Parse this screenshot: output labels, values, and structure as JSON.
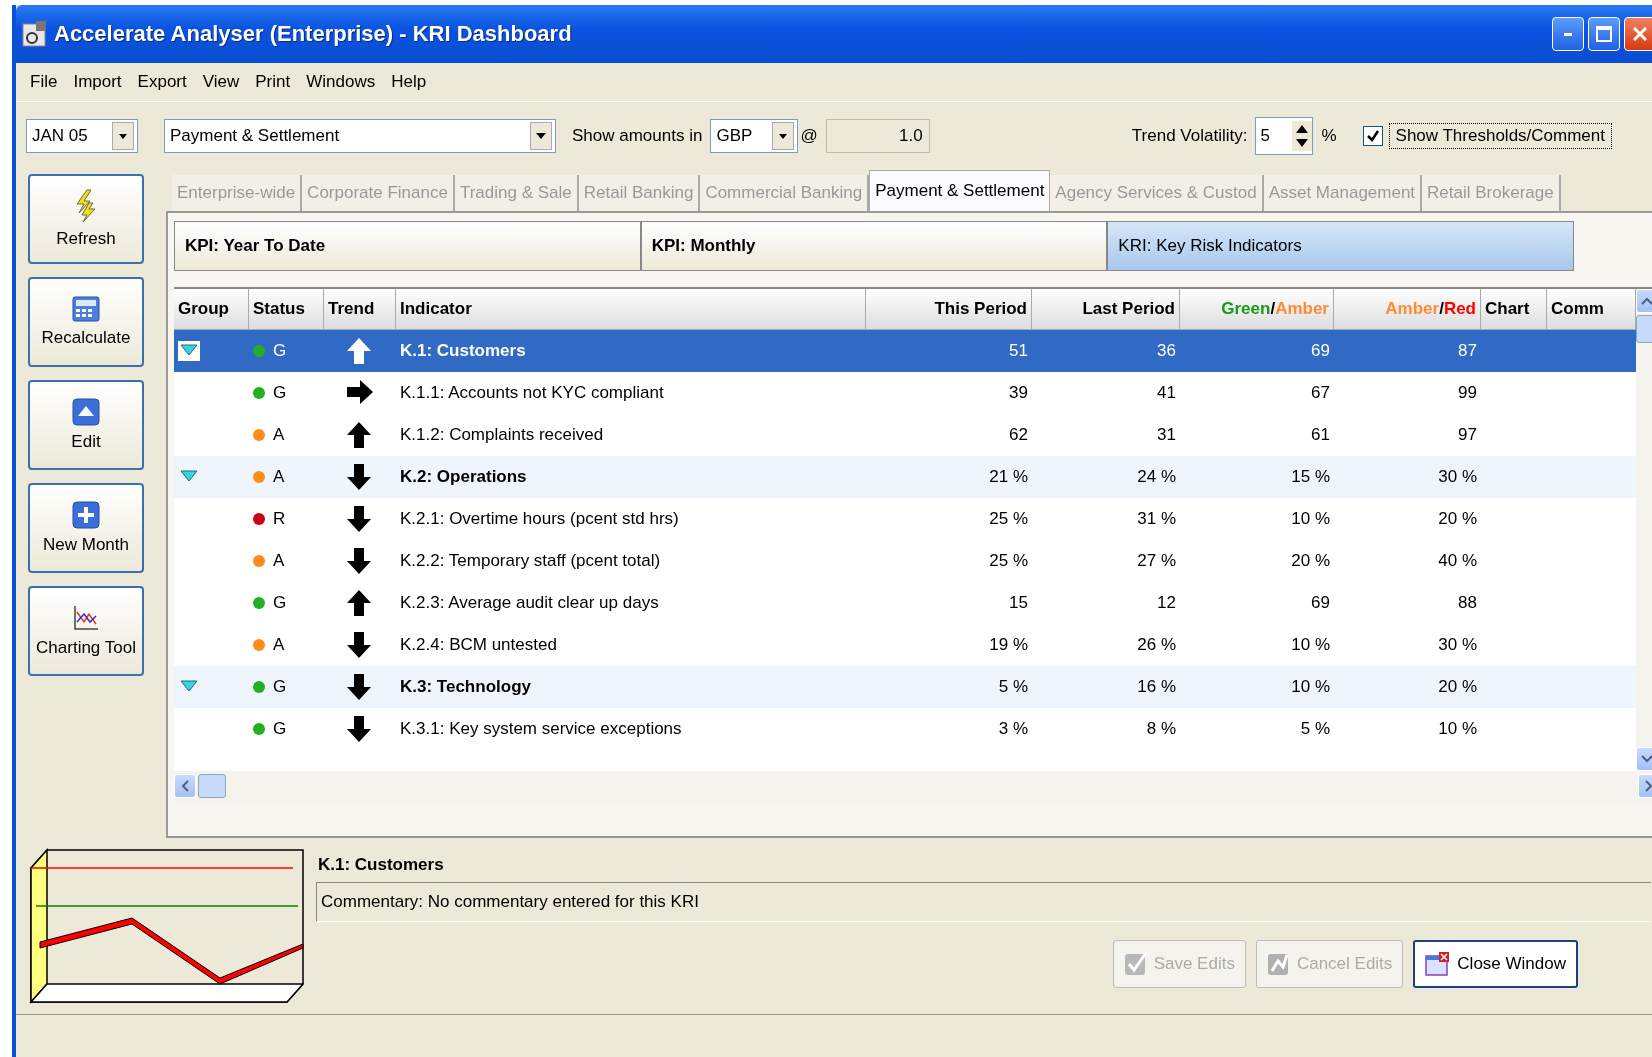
{
  "window": {
    "title": "Accelerate Analyser (Enterprise) - KRI Dashboard"
  },
  "menu": [
    "File",
    "Import",
    "Export",
    "View",
    "Print",
    "Windows",
    "Help"
  ],
  "toolbar": {
    "month": "JAN 05",
    "category": "Payment & Settlement",
    "amounts_label": "Show amounts in",
    "currency": "GBP",
    "at": "@",
    "rate": "1.0",
    "volatility_label": "Trend Volatility:",
    "volatility": "5",
    "percent": "%",
    "show_thresholds": {
      "label": "Show Thresholds/Comment",
      "checked": true
    }
  },
  "side_buttons": [
    {
      "label": "Refresh"
    },
    {
      "label": "Recalculate"
    },
    {
      "label": "Edit"
    },
    {
      "label": "New Month"
    },
    {
      "label": "Charting Tool"
    }
  ],
  "tabs": [
    {
      "label": "Enterprise-wide",
      "selected": false
    },
    {
      "label": "Corporate Finance",
      "selected": false
    },
    {
      "label": "Trading & Sale",
      "selected": false
    },
    {
      "label": "Retail Banking",
      "selected": false
    },
    {
      "label": "Commercial Banking",
      "selected": false
    },
    {
      "label": "Payment & Settlement",
      "selected": true
    },
    {
      "label": "Agency Services & Custod",
      "selected": false
    },
    {
      "label": "Asset Management",
      "selected": false
    },
    {
      "label": "Retail Brokerage",
      "selected": false
    }
  ],
  "subtabs": [
    {
      "label": "KPI: Year To Date",
      "selected": false
    },
    {
      "label": "KPI: Monthly",
      "selected": false
    },
    {
      "label": "KRI: Key Risk Indicators",
      "selected": true
    }
  ],
  "table": {
    "columns": [
      {
        "label": "Group"
      },
      {
        "label": "Status"
      },
      {
        "label": "Trend"
      },
      {
        "label": "Indicator"
      },
      {
        "label": "This Period"
      },
      {
        "label": "Last Period"
      },
      {
        "parts": [
          {
            "text": "Green",
            "color": "#1a9a1a"
          },
          {
            "text": "/",
            "color": "#000000"
          },
          {
            "text": "Amber",
            "color": "#ff8c33"
          }
        ]
      },
      {
        "parts": [
          {
            "text": "Amber",
            "color": "#ff8c33"
          },
          {
            "text": "/",
            "color": "#000000"
          },
          {
            "text": "Red",
            "color": "#ff0000"
          }
        ]
      },
      {
        "label": "Chart"
      },
      {
        "label": "Comm"
      }
    ],
    "rows": [
      {
        "kind": "group",
        "expanded": true,
        "selected": true,
        "status": "G",
        "color": "#22b022",
        "trend": {
          "kind": "up"
        },
        "indicator": "K.1: Customers",
        "values": [
          "51",
          "36",
          "69",
          "87"
        ]
      },
      {
        "kind": "item",
        "selected": false,
        "status": "G",
        "color": "#22b022",
        "trend": {
          "kind": "right"
        },
        "indicator": "K.1.1: Accounts not KYC compliant",
        "values": [
          "39",
          "41",
          "67",
          "99"
        ]
      },
      {
        "kind": "item",
        "selected": false,
        "status": "A",
        "color": "#ff8c1a",
        "trend": {
          "kind": "up"
        },
        "indicator": "K.1.2: Complaints received",
        "values": [
          "62",
          "31",
          "61",
          "97"
        ]
      },
      {
        "kind": "group",
        "expanded": true,
        "selected": false,
        "status": "A",
        "color": "#ff8c1a",
        "trend": {
          "kind": "down"
        },
        "indicator": "K.2: Operations",
        "values": [
          "21 %",
          "24 %",
          "15 %",
          "30 %"
        ]
      },
      {
        "kind": "item",
        "selected": false,
        "status": "R",
        "color": "#cc0011",
        "trend": {
          "kind": "down"
        },
        "indicator": "K.2.1: Overtime hours (pcent std hrs)",
        "values": [
          "25 %",
          "31 %",
          "10 %",
          "20 %"
        ]
      },
      {
        "kind": "item",
        "selected": false,
        "status": "A",
        "color": "#ff8c1a",
        "trend": {
          "kind": "down"
        },
        "indicator": "K.2.2: Temporary staff (pcent total)",
        "values": [
          "25 %",
          "27 %",
          "20 %",
          "40 %"
        ]
      },
      {
        "kind": "item",
        "selected": false,
        "status": "G",
        "color": "#22b022",
        "trend": {
          "kind": "up"
        },
        "indicator": "K.2.3: Average audit clear up days",
        "values": [
          "15",
          "12",
          "69",
          "88"
        ]
      },
      {
        "kind": "item",
        "selected": false,
        "status": "A",
        "color": "#ff8c1a",
        "trend": {
          "kind": "down"
        },
        "indicator": "K.2.4: BCM untested",
        "values": [
          "19 %",
          "26 %",
          "10 %",
          "30 %"
        ]
      },
      {
        "kind": "group",
        "expanded": true,
        "selected": false,
        "status": "G",
        "color": "#22b022",
        "trend": {
          "kind": "down"
        },
        "indicator": "K.3: Technology",
        "values": [
          "5 %",
          "16 %",
          "10 %",
          "20 %"
        ]
      },
      {
        "kind": "item",
        "selected": false,
        "status": "G",
        "color": "#22b022",
        "trend": {
          "kind": "down"
        },
        "indicator": "K.3.1: Key system service exceptions",
        "values": [
          "3 %",
          "8 %",
          "5 %",
          "10 %"
        ]
      }
    ]
  },
  "detail": {
    "title": "K.1: Customers",
    "commentary": "Commentary: No commentary entered for this KRI"
  },
  "buttons": [
    {
      "label": "Save Edits",
      "disabled": true
    },
    {
      "label": "Cancel Edits",
      "disabled": true
    },
    {
      "label": "Close Window",
      "disabled": false
    }
  ]
}
